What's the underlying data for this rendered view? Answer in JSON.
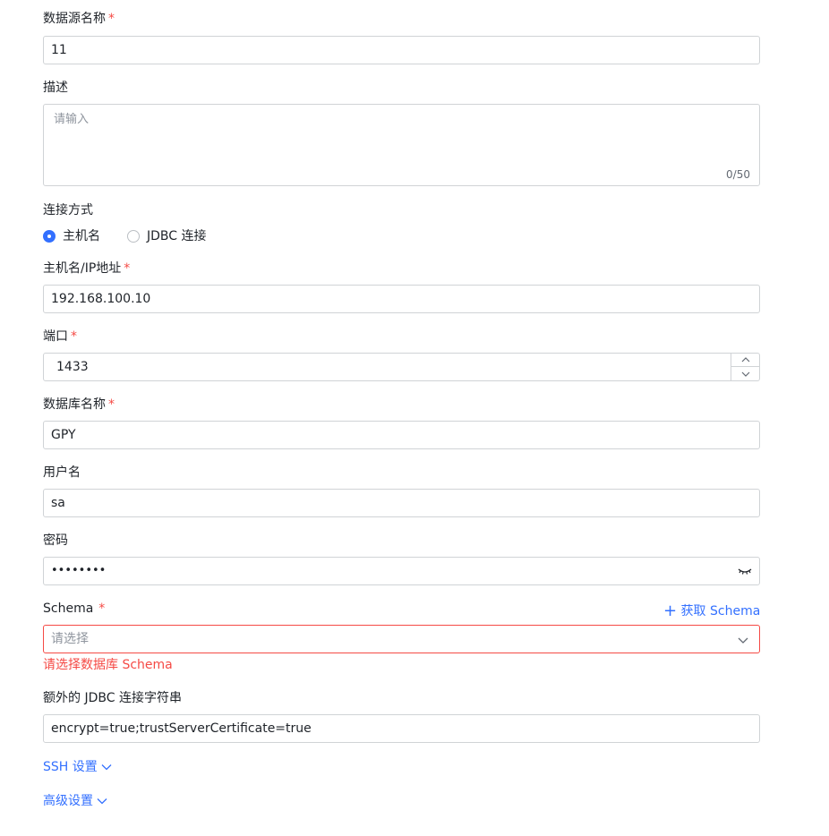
{
  "fields": {
    "name": {
      "label": "数据源名称",
      "required": "*",
      "value": "11"
    },
    "description": {
      "label": "描述",
      "placeholder": "请输入",
      "count": "0/50"
    },
    "conn_mode": {
      "label": "连接方式",
      "options": [
        "主机名",
        "JDBC 连接"
      ],
      "selected": "主机名"
    },
    "host": {
      "label": "主机名/IP地址",
      "required": "*",
      "value": "192.168.100.10"
    },
    "port": {
      "label": "端口",
      "required": "*",
      "value": "1433"
    },
    "database": {
      "label": "数据库名称",
      "required": "*",
      "value": "GPY"
    },
    "username": {
      "label": "用户名",
      "value": "sa"
    },
    "password": {
      "label": "密码",
      "value": "••••••••"
    },
    "schema": {
      "label": "Schema",
      "required": "*",
      "placeholder": "请选择",
      "fetch_link": "获取 Schema",
      "error": "请选择数据库 Schema"
    },
    "jdbc_extra": {
      "label": "额外的 JDBC 连接字符串",
      "value": "encrypt=true;trustServerCertificate=true"
    }
  },
  "sections": {
    "ssh": "SSH 设置",
    "advanced": "高级设置"
  },
  "colors": {
    "primary": "#3370ff",
    "error": "#f54a45",
    "border": "#d0d3d6",
    "placeholder": "#8f959e"
  },
  "icons": {
    "radio": "radio-icon",
    "stepper_up": "chevron-up-icon",
    "stepper_down": "chevron-down-icon",
    "eye": "eye-closed-icon",
    "select": "chevron-down-icon",
    "plus": "plus-icon"
  }
}
